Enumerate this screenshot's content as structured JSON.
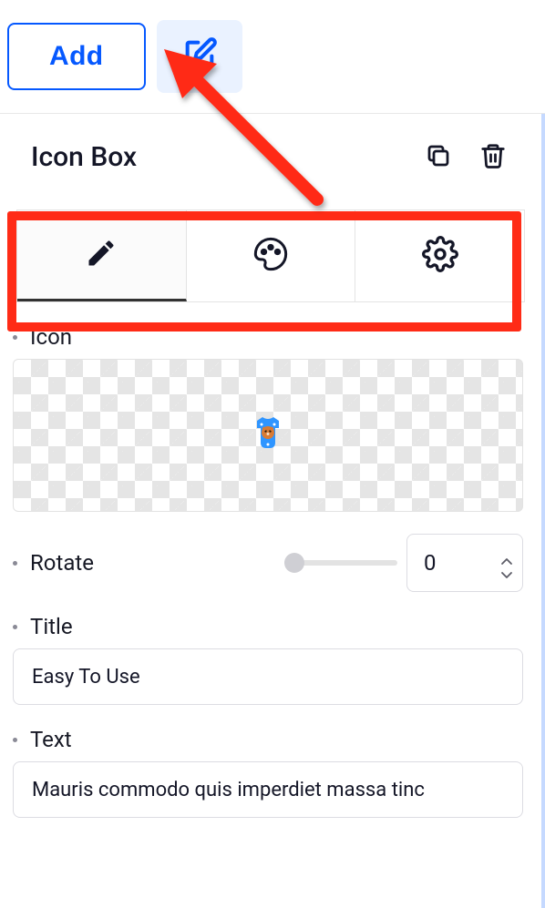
{
  "toolbar": {
    "add_label": "Add"
  },
  "panel": {
    "title": "Icon Box"
  },
  "tabs": {
    "content_icon": "pencil-icon",
    "style_icon": "palette-icon",
    "settings_icon": "gear-icon"
  },
  "fields": {
    "icon": {
      "label": "Icon"
    },
    "rotate": {
      "label": "Rotate",
      "value": "0"
    },
    "title": {
      "label": "Title",
      "value": "Easy To Use"
    },
    "text": {
      "label": "Text",
      "value": "Mauris commodo quis imperdiet massa tinc"
    }
  }
}
